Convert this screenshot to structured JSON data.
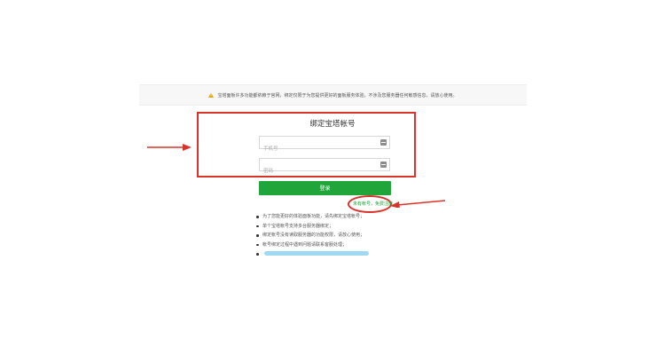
{
  "notice": {
    "text": "宝塔面板许多功能都依赖于官网，绑定仅限于为您提供更好的面板服务体验，不涉及您服务器任何敏感信息，请放心使用。",
    "icon": "warning-icon"
  },
  "login": {
    "title": "绑定宝塔帐号",
    "phone_placeholder": "手机号",
    "password_placeholder": "密码",
    "submit_label": "登录",
    "register_label": "未有帐号，免费注册"
  },
  "tips": [
    "为了您能更好的体验面板功能，请先绑定宝塔帐号；",
    "单个宝塔帐号支持多台服务器绑定；",
    "绑定帐号没有读取服务器的功能权限，请放心使用；",
    "帐号绑定过程中遇到问题请联系客服处理；"
  ],
  "colors": {
    "accent_green": "#20a53a",
    "annotation_red": "#d9342b",
    "warning_yellow": "#e6a817"
  }
}
